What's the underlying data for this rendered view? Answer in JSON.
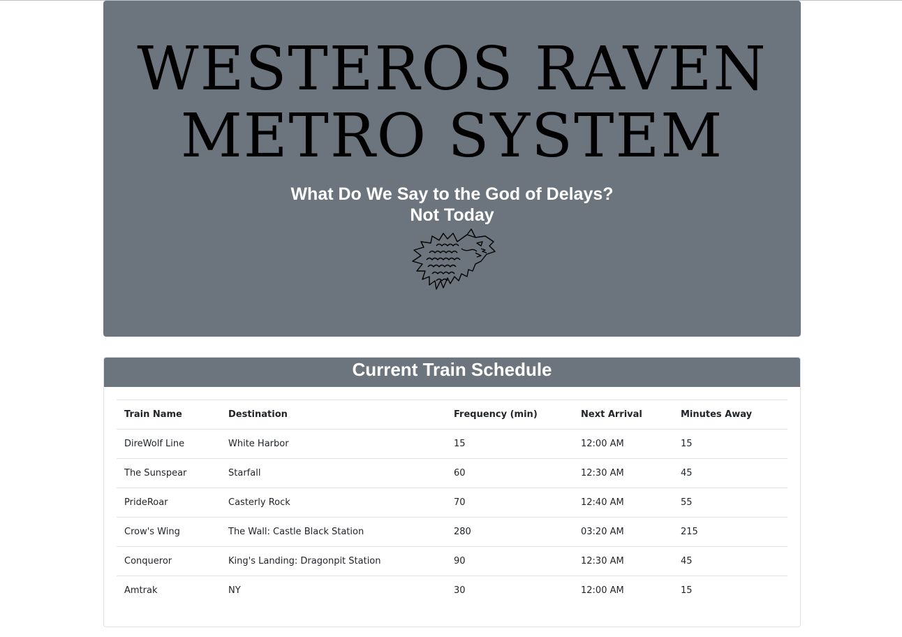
{
  "header": {
    "title_line1": "Westeros Raven",
    "title_line2": "Metro System",
    "tagline_line1": "What Do We Say to the God of Delays?",
    "tagline_line2": "Not Today",
    "sigil_icon": "direwolf-sigil-icon"
  },
  "schedule": {
    "title": "Current Train Schedule",
    "columns": [
      "Train Name",
      "Destination",
      "Frequency (min)",
      "Next Arrival",
      "Minutes Away"
    ],
    "rows": [
      [
        "DireWolf Line",
        "White Harbor",
        "15",
        "12:00 AM",
        "15"
      ],
      [
        "The Sunspear",
        "Starfall",
        "60",
        "12:30 AM",
        "45"
      ],
      [
        "PrideRoar",
        "Casterly Rock",
        "70",
        "12:40 AM",
        "55"
      ],
      [
        "Crow's Wing",
        "The Wall: Castle Black Station",
        "280",
        "03:20 AM",
        "215"
      ],
      [
        "Conqueror",
        "King's Landing: Dragonpit Station",
        "90",
        "12:30 AM",
        "45"
      ],
      [
        "Amtrak",
        "NY",
        "30",
        "12:00 AM",
        "15"
      ]
    ]
  },
  "colors": {
    "header_bg": "#6c757d",
    "title_text": "#000000",
    "tagline_text": "#ffffff",
    "border": "#dee2e6"
  }
}
